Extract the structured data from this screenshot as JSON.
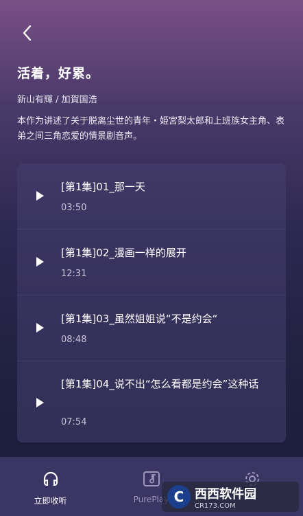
{
  "header": {
    "back_icon": "chevron-left-icon"
  },
  "album": {
    "title": "活着，好累。",
    "authors": "新山有輝 / 加賀国浩",
    "description": "本作为讲述了关于脱离尘世的青年・姫宮梨太郎和上班族女主角、表弟之间三角恋爱的情景剧音声。"
  },
  "episodes": [
    {
      "title": "[第1集]01_那一天",
      "duration": "03:50"
    },
    {
      "title": "[第1集]02_漫画一样的展开",
      "duration": "12:31"
    },
    {
      "title": "[第1集]03_虽然姐姐说“不是约会“",
      "duration": "08:48"
    },
    {
      "title": "[第1集]04_说不出“怎么看都是约会”这种话",
      "duration": "07:54"
    }
  ],
  "tabbar": {
    "tabs": [
      {
        "label": "立即收听",
        "icon": "headphones-icon",
        "active": true
      },
      {
        "label": "PurePlay",
        "icon": "music-folder-icon",
        "active": false
      },
      {
        "label": "",
        "icon": "gear-icon",
        "active": false
      }
    ]
  },
  "watermark": {
    "brand": "西西软件园",
    "url": "CR173.COM"
  },
  "colors": {
    "tab_bg": "#3b3564",
    "card_bg": "#463e6e",
    "accent": "#ffffff"
  }
}
